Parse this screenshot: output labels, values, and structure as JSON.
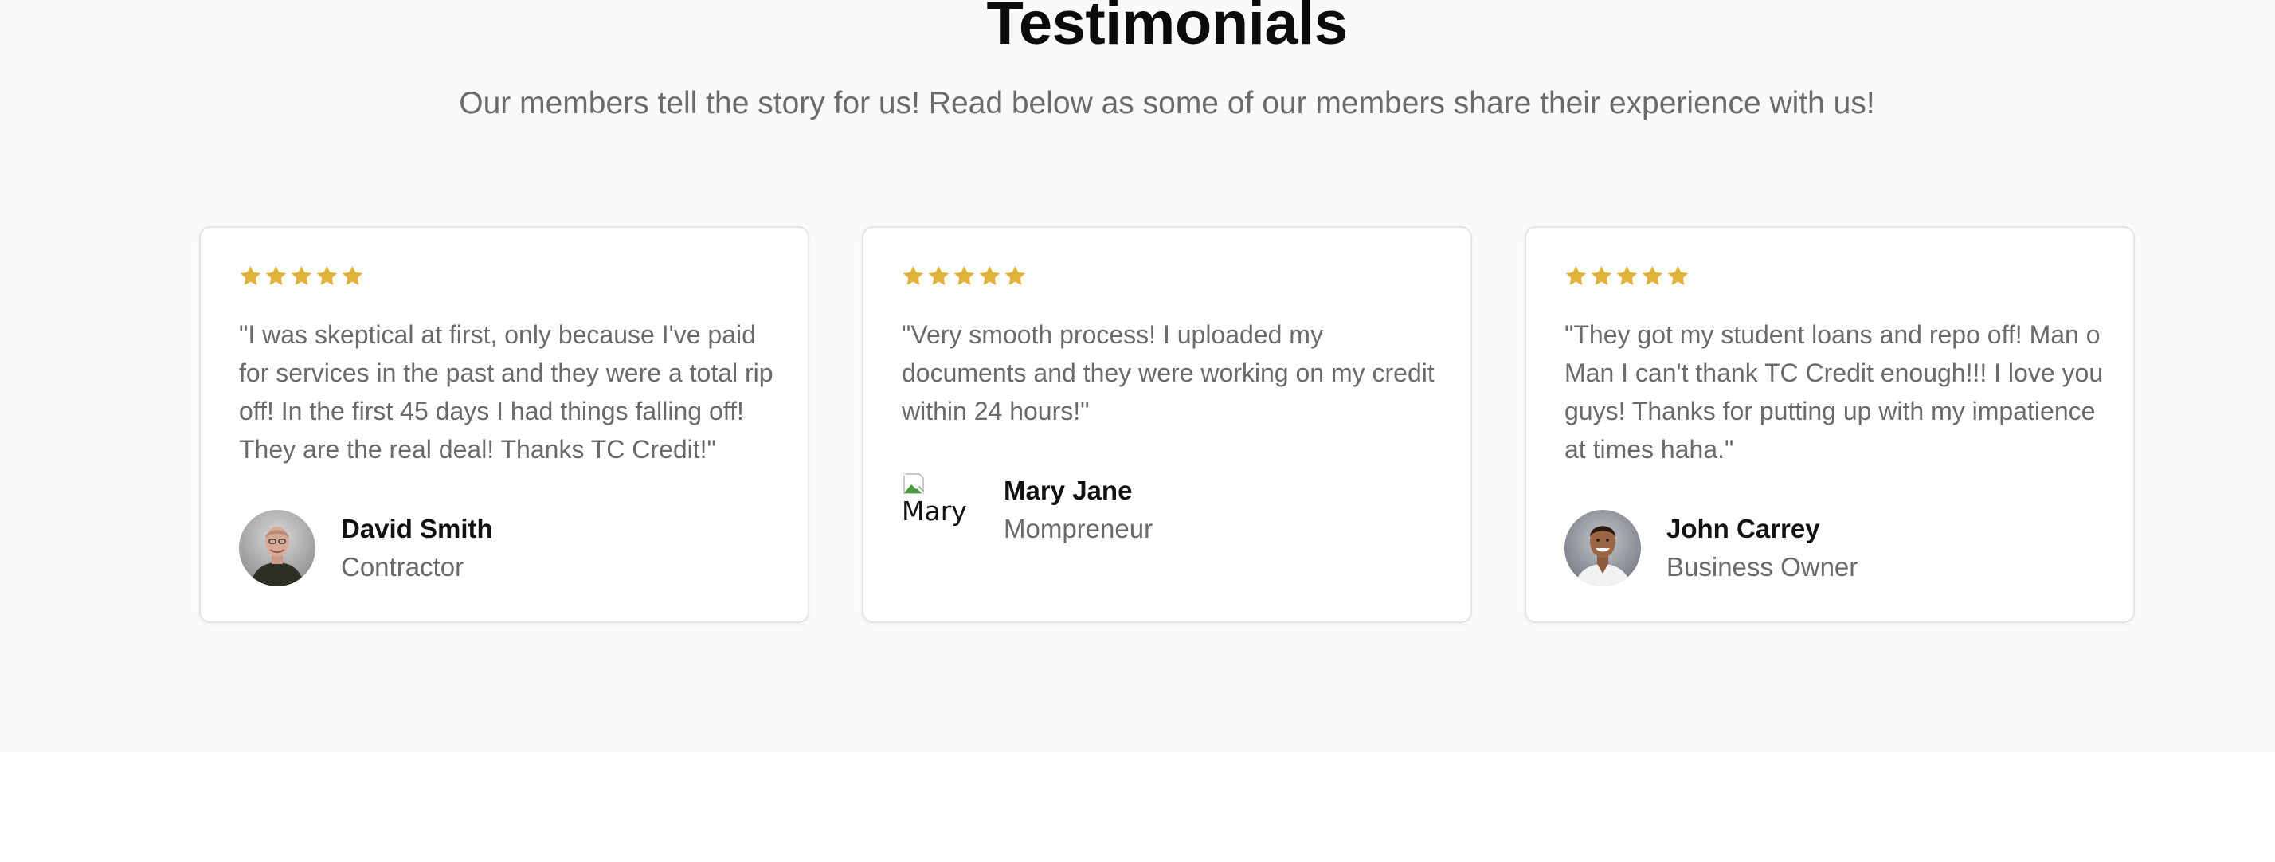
{
  "section": {
    "title": "Testimonials",
    "subtitle": "Our members tell the story for us! Read below as some of our members share their experience with us!"
  },
  "colors": {
    "star": "#e0b33a",
    "section_bg": "#fafafa",
    "text_muted": "#6a6a6a"
  },
  "testimonials": [
    {
      "rating": 5,
      "quote": "\"I was skeptical at first, only because I've paid for services in the past and they were a total rip off! In the first 45 days I had things falling off! They are the real deal! Thanks TC Credit!\"",
      "name": "David Smith",
      "role": "Contractor",
      "avatar_icon": "man-portrait-photo"
    },
    {
      "rating": 5,
      "quote": "\"Very smooth process! I uploaded my documents and they were working on my credit within 24 hours!\"",
      "name": "Mary Jane",
      "role": "Mompreneur",
      "avatar_alt": "Mary",
      "avatar_icon": "broken-image-icon"
    },
    {
      "rating": 5,
      "quote": "\"They got my student loans and repo off! Man o Man I can't thank TC Credit enough!!! I love you guys! Thanks for putting up with my impatience at times haha.\"",
      "name": "John Carrey",
      "role": "Business Owner",
      "avatar_icon": "man-portrait-photo"
    }
  ]
}
